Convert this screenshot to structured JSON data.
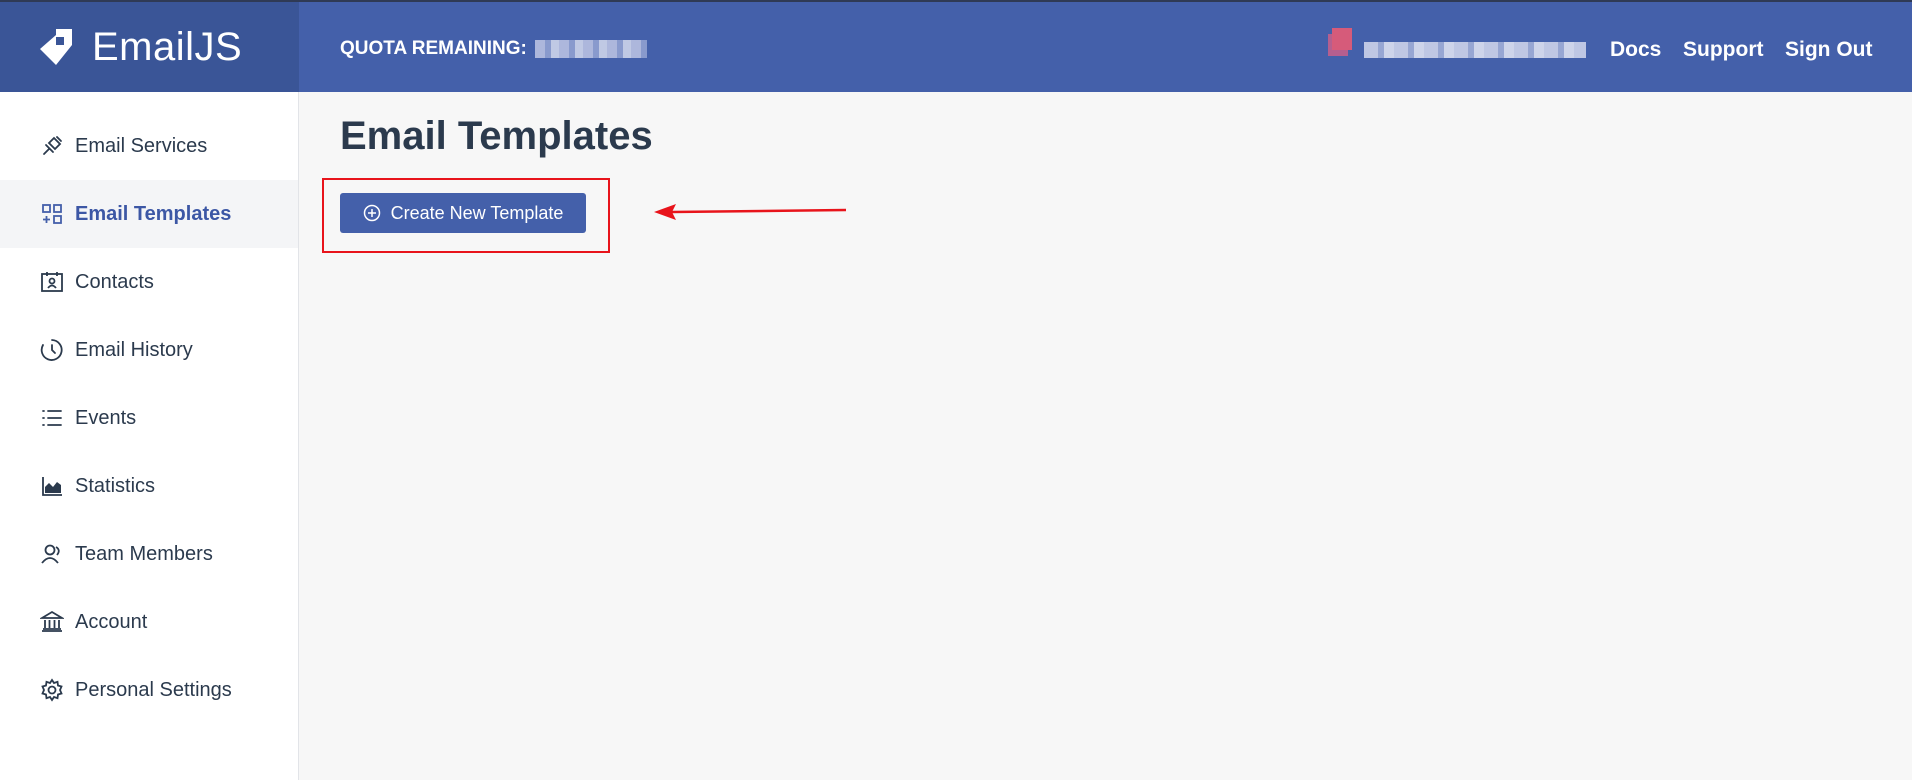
{
  "brand": {
    "name": "EmailJS"
  },
  "header": {
    "quota_label": "QUOTA REMAINING:",
    "links": {
      "docs": "Docs",
      "support": "Support",
      "sign_out": "Sign Out"
    }
  },
  "sidebar": {
    "items": [
      {
        "label": "Email Services",
        "icon": "plug-icon",
        "active": false
      },
      {
        "label": "Email Templates",
        "icon": "templates-grid-icon",
        "active": true
      },
      {
        "label": "Contacts",
        "icon": "contacts-card-icon",
        "active": false
      },
      {
        "label": "Email History",
        "icon": "history-clock-icon",
        "active": false
      },
      {
        "label": "Events",
        "icon": "list-icon",
        "active": false
      },
      {
        "label": "Statistics",
        "icon": "area-chart-icon",
        "active": false
      },
      {
        "label": "Team Members",
        "icon": "team-members-icon",
        "active": false
      },
      {
        "label": "Account",
        "icon": "bank-icon",
        "active": false
      },
      {
        "label": "Personal Settings",
        "icon": "gear-icon",
        "active": false
      }
    ]
  },
  "main": {
    "title": "Email Templates",
    "create_button": "Create New Template"
  },
  "colors": {
    "header": "#4460aa",
    "brand_bg": "#3a5597",
    "accent": "#4460aa",
    "annotation": "#e8141b"
  }
}
